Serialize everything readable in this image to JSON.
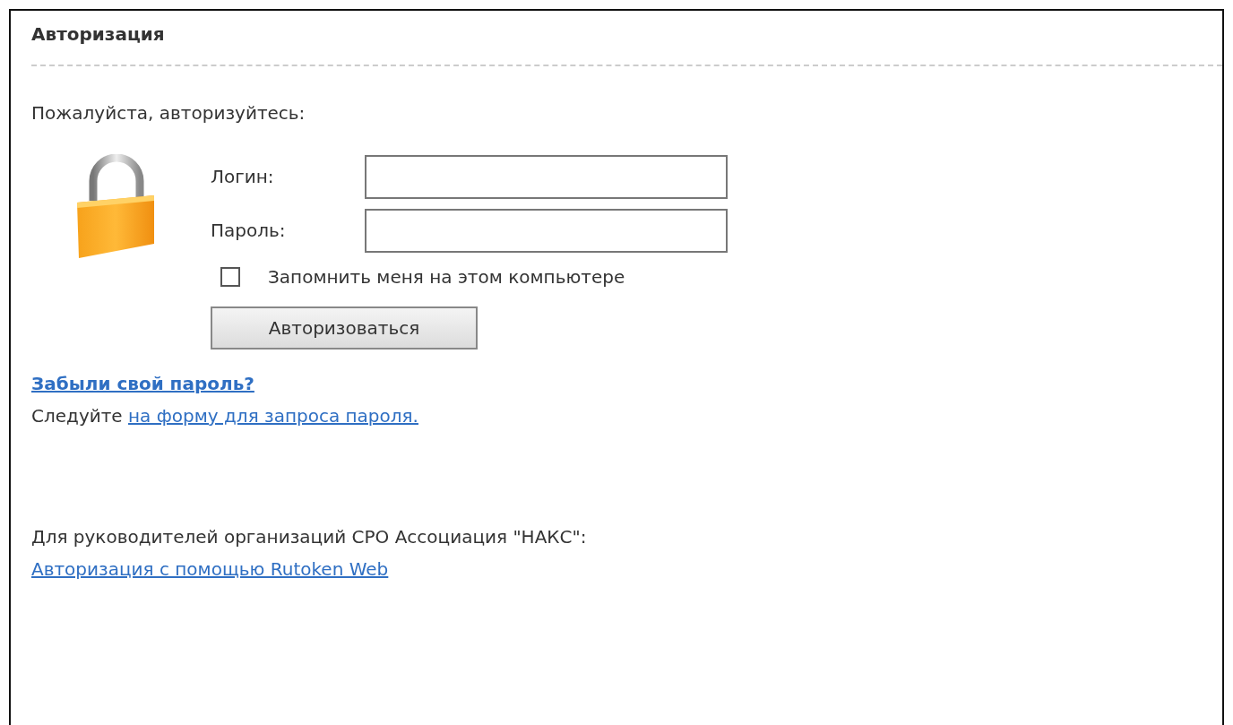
{
  "heading": "Авторизация",
  "prompt": "Пожалуйста, авторизуйтесь:",
  "fields": [
    {
      "label": "Логин:"
    },
    {
      "label": "Пароль:"
    }
  ],
  "remember": {
    "label": "Запомнить меня на этом компьютере",
    "checked": false
  },
  "submit": "Авторизоваться",
  "forgot": {
    "title": "Забыли свой пароль?",
    "text": "Следуйте",
    "link": "на форму для запроса пароля."
  },
  "rutoken": {
    "text": "Для руководителей организаций СРО Ассоциация \"НАКС\":",
    "link": "Авторизация с помощью Rutoken Web"
  }
}
